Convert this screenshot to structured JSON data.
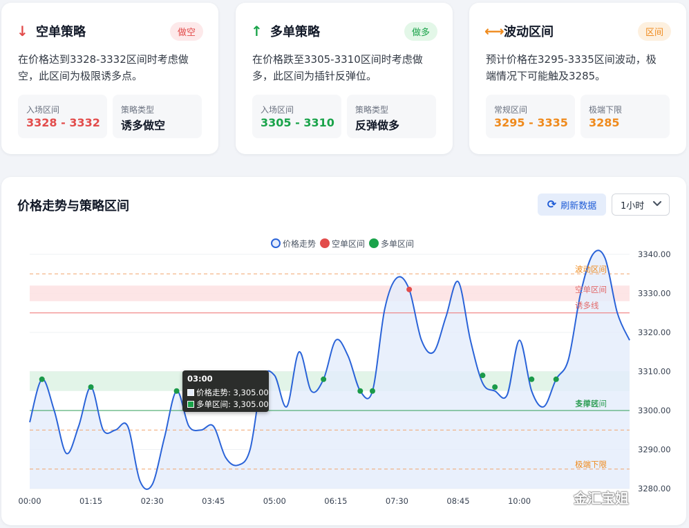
{
  "cards": [
    {
      "icon": "arrow-down-icon",
      "icon_glyph": "↓",
      "title": "空单策略",
      "badge": "做空",
      "accent": "#e24c4b",
      "badge_bg": "#fde9ea",
      "description": "在价格达到3328-3332区间时考虑做空，此区间为极限诱多点。",
      "box1_label": "入场区间",
      "box1_value": "3328 - 3332",
      "box2_label": "策略类型",
      "box2_value": "诱多做空"
    },
    {
      "icon": "arrow-up-icon",
      "icon_glyph": "↑",
      "title": "多单策略",
      "badge": "做多",
      "accent": "#1aa34a",
      "badge_bg": "#e3f7e8",
      "description": "在价格跌至3305-3310区间时考虑做多，此区间为插针反弹位。",
      "box1_label": "入场区间",
      "box1_value": "3305 - 3310",
      "box2_label": "策略类型",
      "box2_value": "反弹做多"
    },
    {
      "icon": "arrow-left-right-icon",
      "icon_glyph": "⟷",
      "title": "波动区间",
      "badge": "区间",
      "accent": "#ef8a1c",
      "badge_bg": "#fdf0df",
      "description": "预计价格在3295-3335区间波动，极端情况下可能触及3285。",
      "box1_label": "常规区间",
      "box1_value": "3295 - 3335",
      "box2_label": "极端下限",
      "box2_value": "3285"
    }
  ],
  "chart_section": {
    "title": "价格走势与策略区间",
    "refresh_label": "刷新数据",
    "refresh_icon": "refresh-icon",
    "timeframe": "1小时",
    "watermark": "金汇宝姐"
  },
  "tooltip": {
    "time": "03:00",
    "row1": "价格走势: 3,305.00",
    "row2": "多单区间: 3,305.00"
  },
  "colors": {
    "price_line": "#2a63d8",
    "price_fill": "#e4ecfb",
    "short_zone": "#fde2e3",
    "long_zone": "#dff3e6",
    "short_marker": "#e24c4b",
    "long_marker": "#1a9a49",
    "range_line": "#f2a36b",
    "induce_line": "#ef6f6f",
    "support_line": "#2e9e55"
  },
  "chart_data": {
    "type": "line",
    "legend": [
      "价格走势",
      "空单区间",
      "多单区间"
    ],
    "legend_position": "top-center",
    "x_ticks": [
      "00:00",
      "01:15",
      "02:30",
      "03:45",
      "05:00",
      "06:15",
      "07:30",
      "08:45",
      "10:00"
    ],
    "y_ticks": [
      "3340.00",
      "3330.00",
      "3320.00",
      "3310.00",
      "3300.00",
      "3290.00",
      "3280.00"
    ],
    "ylim": [
      3280,
      3340
    ],
    "x_range_hours": [
      0,
      12.25
    ],
    "grid": true,
    "bands": [
      {
        "name": "空单区间",
        "from": 3328,
        "to": 3332
      },
      {
        "name": "多单区间",
        "from": 3305,
        "to": 3310
      }
    ],
    "lines": [
      {
        "label": "波动区间",
        "value": 3335,
        "style": "dashed"
      },
      {
        "label": "诱多线",
        "value": 3325,
        "style": "solid"
      },
      {
        "label": "支撑线",
        "value": 3300,
        "style": "solid"
      },
      {
        "label": "",
        "value": 3295,
        "style": "dashed"
      },
      {
        "label": "极端下限",
        "value": 3285,
        "style": "dashed"
      }
    ],
    "band_labels": [
      {
        "text": "波动区间",
        "value": 3335
      },
      {
        "text": "空单区间",
        "value": 3332
      },
      {
        "text": "诱多线",
        "value": 3325
      },
      {
        "text": "多单区间",
        "value": 3300
      },
      {
        "text": "支撑线",
        "value": 3300
      },
      {
        "text": "极端下限",
        "value": 3285
      }
    ],
    "series": [
      {
        "name": "价格走势",
        "x": [
          0,
          0.25,
          0.5,
          0.75,
          1.0,
          1.25,
          1.5,
          1.75,
          2.0,
          2.25,
          2.5,
          2.75,
          3.0,
          3.25,
          3.5,
          3.75,
          4.0,
          4.25,
          4.5,
          4.75,
          5.0,
          5.25,
          5.5,
          5.75,
          6.0,
          6.25,
          6.5,
          6.75,
          7.0,
          7.25,
          7.5,
          7.75,
          8.0,
          8.25,
          8.5,
          8.75,
          9.0,
          9.25,
          9.5,
          9.75,
          10.0,
          10.25,
          10.5,
          10.75,
          11.0,
          11.25,
          11.5,
          11.75,
          12.0,
          12.25
        ],
        "values": [
          3297,
          3308,
          3300,
          3289,
          3296,
          3306,
          3295,
          3295,
          3296,
          3282,
          3281,
          3293,
          3305,
          3296,
          3295,
          3296,
          3288,
          3286,
          3290,
          3308,
          3309,
          3301,
          3315,
          3305,
          3308,
          3318,
          3314,
          3305,
          3305,
          3326,
          3334,
          3331,
          3318,
          3315,
          3324,
          3333,
          3318,
          3307,
          3305,
          3304,
          3318,
          3305,
          3301,
          3308,
          3313,
          3330,
          3340,
          3339,
          3325,
          3318
        ]
      }
    ],
    "markers": [
      {
        "series": "多单区间",
        "x": 0.25,
        "y": 3308
      },
      {
        "series": "多单区间",
        "x": 1.25,
        "y": 3306
      },
      {
        "series": "多单区间",
        "x": 3.0,
        "y": 3305
      },
      {
        "series": "多单区间",
        "x": 6.0,
        "y": 3308
      },
      {
        "series": "多单区间",
        "x": 6.75,
        "y": 3305
      },
      {
        "series": "多单区间",
        "x": 7.0,
        "y": 3305
      },
      {
        "series": "空单区间",
        "x": 7.75,
        "y": 3331
      },
      {
        "series": "多单区间",
        "x": 9.25,
        "y": 3309
      },
      {
        "series": "多单区间",
        "x": 9.5,
        "y": 3306
      },
      {
        "series": "多单区间",
        "x": 10.25,
        "y": 3308
      },
      {
        "series": "多单区间",
        "x": 10.75,
        "y": 3308
      }
    ]
  }
}
